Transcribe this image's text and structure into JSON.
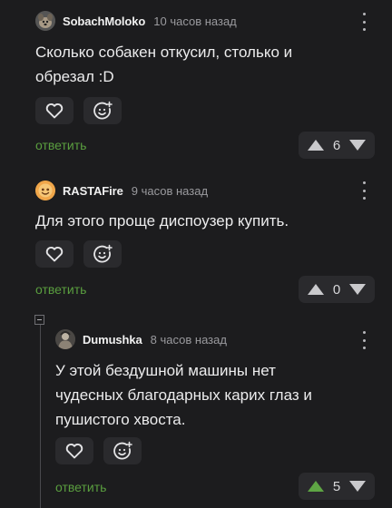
{
  "comments": [
    {
      "username": "SobachMoloko",
      "time": "10 часов назад",
      "text": "Сколько собакен откусил, столько и\nобрезал :D",
      "reply_label": "ответить",
      "rating": "6",
      "avatar_icon": "dog-avatar-icon"
    },
    {
      "username": "RASTAFire",
      "time": "9 часов назад",
      "text": "Для этого проще диспоузер купить.",
      "reply_label": "ответить",
      "rating": "0",
      "avatar_icon": "smiley-avatar-icon"
    },
    {
      "username": "Dumushka",
      "time": "8 часов назад",
      "text": "У этой бездушной машины нет\nчудесных благодарных карих глаз и\nпушистого хвоста.",
      "reply_label": "ответить",
      "rating": "5",
      "avatar_icon": "figure-avatar-icon"
    }
  ],
  "colors": {
    "background": "#1c1c1e",
    "reply_green": "#5a9e3f",
    "upvote_active": "#5ea544",
    "button_bg": "#2a2a2d"
  }
}
